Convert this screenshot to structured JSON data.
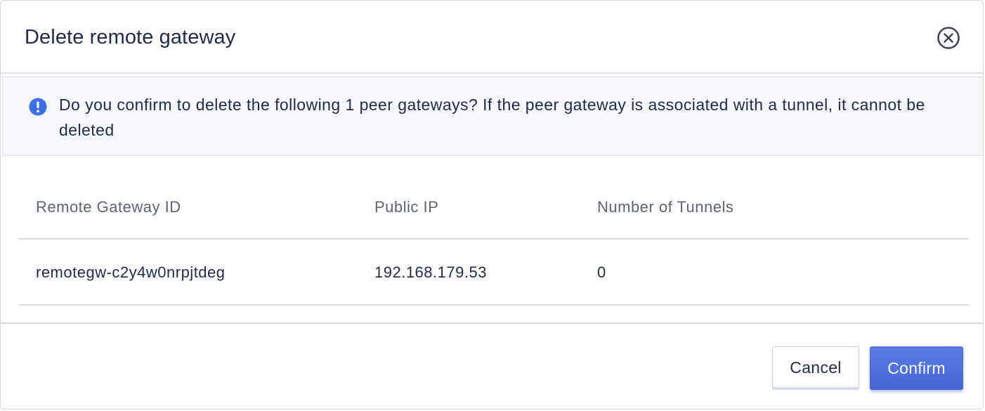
{
  "dialog": {
    "title": "Delete remote gateway",
    "close_icon": "close-circle-icon"
  },
  "alert": {
    "icon": "info-exclamation-icon",
    "accent_color": "#3b6ee8",
    "message": "Do you confirm to delete the following 1 peer gateways? If the peer gateway is associated with a tunnel, it cannot be deleted"
  },
  "table": {
    "columns": [
      "Remote Gateway ID",
      "Public IP",
      "Number of Tunnels"
    ],
    "rows": [
      [
        "remotegw-c2y4w0nrpjtdeg",
        "192.168.179.53",
        "0"
      ]
    ]
  },
  "footer": {
    "cancel_label": "Cancel",
    "confirm_label": "Confirm",
    "confirm_color": "#4c6fdb"
  }
}
